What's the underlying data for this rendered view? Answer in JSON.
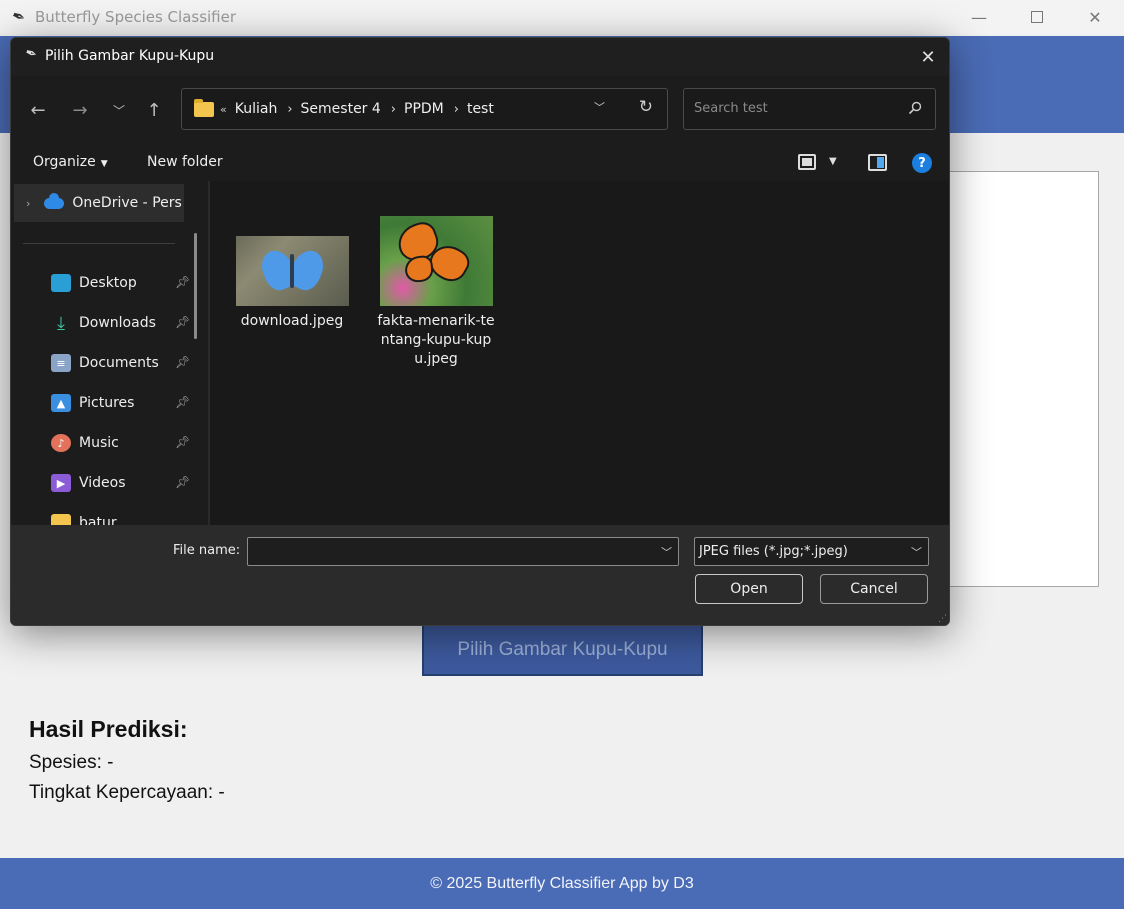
{
  "app": {
    "title": "Butterfly Species Classifier",
    "pick_button": "Pilih Gambar Kupu-Kupu",
    "result_title": "Hasil Prediksi:",
    "species_line": "Spesies: -",
    "confidence_line": "Tingkat Kepercayaan: -",
    "footer": "© 2025 Butterfly Classifier App by D3",
    "header_color": "#4a6bb5"
  },
  "dialog": {
    "title": "Pilih Gambar Kupu-Kupu",
    "breadcrumb": [
      "Kuliah",
      "Semester 4",
      "PPDM",
      "test"
    ],
    "breadcrumb_more": "«",
    "search_placeholder": "Search test",
    "toolbar": {
      "organize": "Organize",
      "new_folder": "New folder"
    },
    "sidebar": {
      "onedrive": "OneDrive - Pers",
      "items": [
        {
          "label": "Desktop",
          "icon": "desktop-icon"
        },
        {
          "label": "Downloads",
          "icon": "downloads-icon"
        },
        {
          "label": "Documents",
          "icon": "documents-icon"
        },
        {
          "label": "Pictures",
          "icon": "pictures-icon"
        },
        {
          "label": "Music",
          "icon": "music-icon"
        },
        {
          "label": "Videos",
          "icon": "videos-icon"
        },
        {
          "label": "batur",
          "icon": "folder-icon"
        }
      ]
    },
    "files": [
      {
        "name": "download.jpeg"
      },
      {
        "name": "fakta-menarik-te ntang-kupu-kup u.jpeg"
      }
    ],
    "file_name_label": "File name:",
    "file_name_value": "",
    "file_type": "JPEG files (*.jpg;*.jpeg)",
    "open_button": "Open",
    "cancel_button": "Cancel"
  }
}
